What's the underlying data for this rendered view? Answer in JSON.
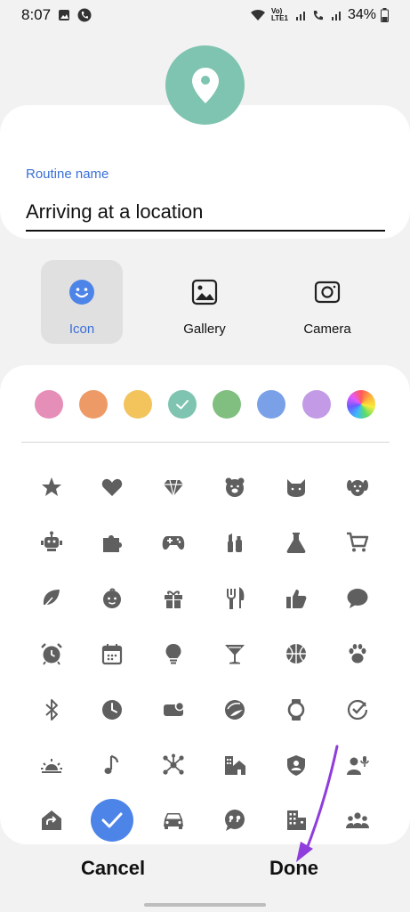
{
  "status_bar": {
    "time": "8:07",
    "network_label": "Vo) LTE1",
    "battery": "34%"
  },
  "routine": {
    "label": "Routine name",
    "value": "Arriving at a location"
  },
  "type_options": [
    {
      "label": "Icon",
      "icon": "smiley-icon",
      "selected": true
    },
    {
      "label": "Gallery",
      "icon": "image-icon",
      "selected": false
    },
    {
      "label": "Camera",
      "icon": "camera-icon",
      "selected": false
    }
  ],
  "colors": [
    "#e58fb8",
    "#ee9a67",
    "#f3c35c",
    "#7ec4b0",
    "#80bf80",
    "#7aa1e8",
    "#c29ae6",
    "rainbow"
  ],
  "selected_color_index": 3,
  "icons": [
    "star-icon",
    "heart-icon",
    "diamond-icon",
    "bear-icon",
    "cat-icon",
    "dog-icon",
    "robot-icon",
    "puzzle-icon",
    "gamepad-icon",
    "cosmetics-icon",
    "flask-icon",
    "cart-icon",
    "leaf-icon",
    "baby-icon",
    "gift-icon",
    "utensils-icon",
    "thumbs-up-icon",
    "speech-bubble-icon",
    "alarm-clock-icon",
    "calendar-icon",
    "lightbulb-icon",
    "cocktail-icon",
    "basketball-icon",
    "paw-icon",
    "bluetooth-icon",
    "clock-icon",
    "toggle-icon",
    "moon-icon",
    "watch-icon",
    "check-rotate-icon",
    "sunrise-icon",
    "music-note-icon",
    "molecule-icon",
    "home-buildings-icon",
    "shield-person-icon",
    "person-mic-icon",
    "share-home-icon",
    "checkmark-icon",
    "car-icon",
    "quote-bubble-icon",
    "office-building-icon",
    "people-group-icon"
  ],
  "selected_icon_index": 37,
  "buttons": {
    "cancel": "Cancel",
    "done": "Done"
  }
}
